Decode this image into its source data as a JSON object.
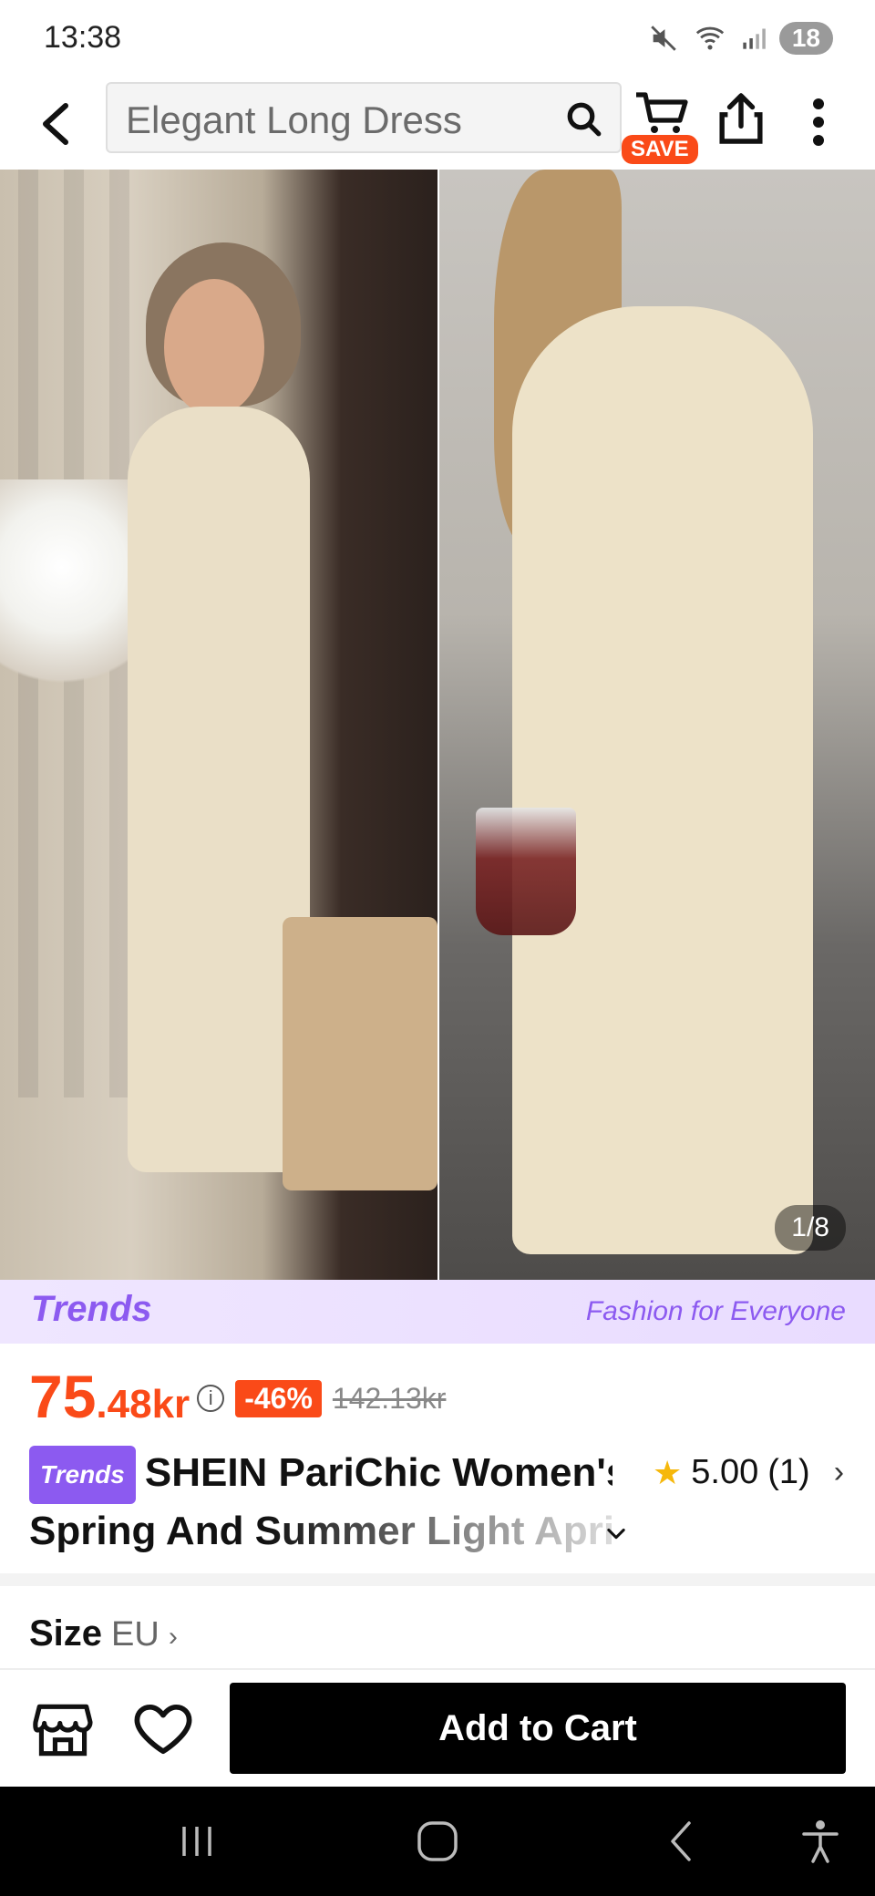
{
  "status_bar": {
    "time": "13:38",
    "battery": "18"
  },
  "header": {
    "search_text": "Elegant Long Dress",
    "save_badge": "SAVE"
  },
  "gallery": {
    "counter": "1/8"
  },
  "trends_banner": {
    "logo": "Trends",
    "tagline": "Fashion for Everyone"
  },
  "price": {
    "main": "75",
    "fraction": ".48kr",
    "info_glyph": "i",
    "discount": "-46%",
    "original": "142.13kr"
  },
  "product": {
    "chip": "Trends",
    "title_line1": "SHEIN PariChic Women's",
    "title_line2": "Spring And Summer Light Apri"
  },
  "rating": {
    "value": "5.00",
    "count": "(1)"
  },
  "size": {
    "label": "Size",
    "region": "EU"
  },
  "bottom_bar": {
    "add_to_cart": "Add to Cart"
  },
  "colors": {
    "accent": "#fa4a18",
    "trends_purple": "#8c5af0",
    "star": "#f6b80c"
  },
  "icons": [
    "back-icon",
    "search-icon",
    "cart-icon",
    "share-icon",
    "more-icon",
    "info-icon",
    "star-icon",
    "chevron-down-icon",
    "chevron-right-icon",
    "store-icon",
    "heart-icon",
    "recent-apps-icon",
    "home-icon",
    "back-nav-icon",
    "accessibility-icon"
  ]
}
